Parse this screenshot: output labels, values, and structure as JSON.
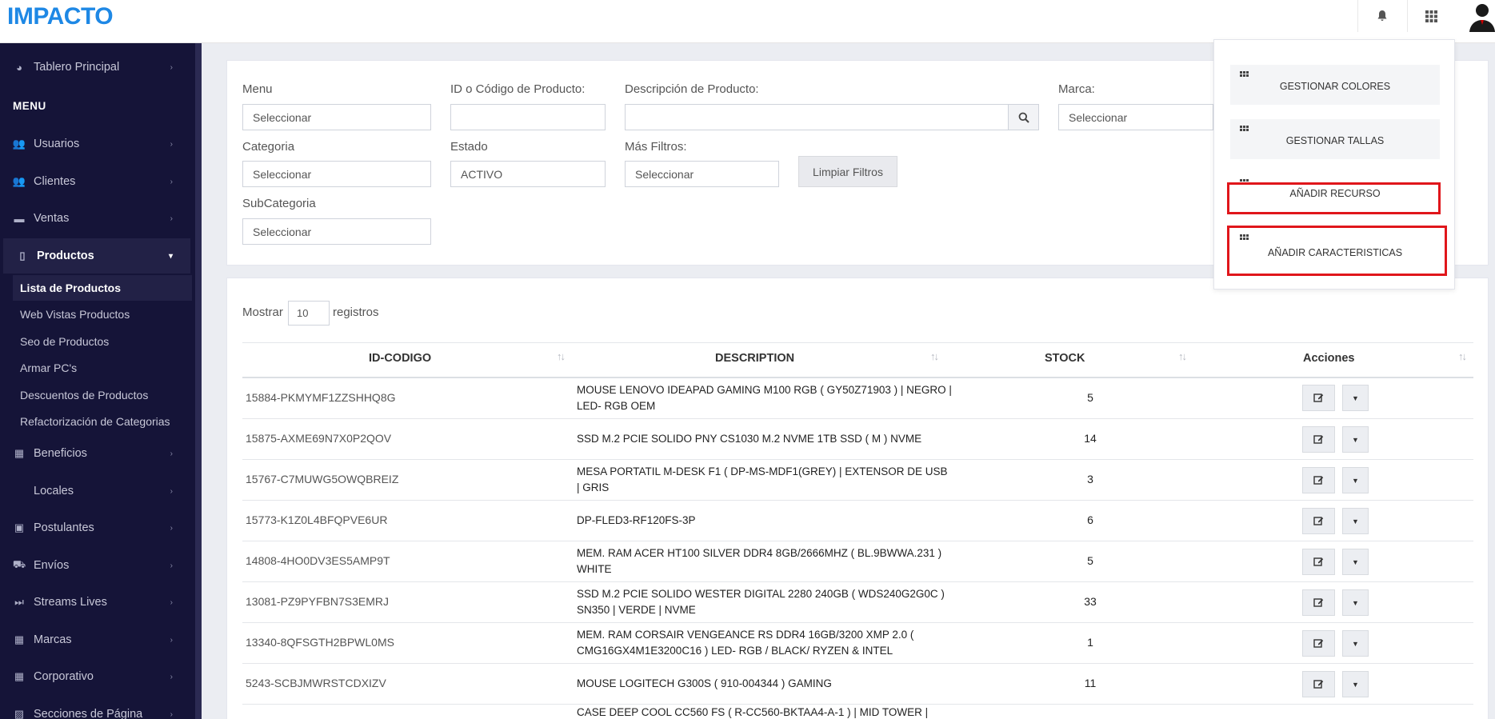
{
  "app": {
    "logo": "IMPACTO"
  },
  "sidebar": {
    "top_item": "Tablero Principal",
    "menu_header": "MENU",
    "items": [
      {
        "label": "Usuarios",
        "icon": "users-icon"
      },
      {
        "label": "Clientes",
        "icon": "users-icon"
      },
      {
        "label": "Ventas",
        "icon": "money-icon"
      },
      {
        "label": "Productos",
        "icon": "box-icon",
        "active": true
      },
      {
        "label": "Beneficios",
        "icon": "grid-icon"
      },
      {
        "label": "Locales",
        "icon": ""
      },
      {
        "label": "Postulantes",
        "icon": "briefcase-icon"
      },
      {
        "label": "Envíos",
        "icon": "truck-icon"
      },
      {
        "label": "Streams Lives",
        "icon": "skip-icon"
      },
      {
        "label": "Marcas",
        "icon": "grid-icon"
      },
      {
        "label": "Corporativo",
        "icon": "grid-icon"
      },
      {
        "label": "Secciones de Página",
        "icon": "image-icon"
      }
    ],
    "subitems": [
      "Lista de Productos",
      "Web Vistas Productos",
      "Seo de Productos",
      "Armar PC's",
      "Descuentos de Productos",
      "Refactorización de Categorias"
    ]
  },
  "filters": {
    "menu_label": "Menu",
    "menu_value": "Seleccionar",
    "id_label": "ID o Código de Producto:",
    "id_value": "",
    "desc_label": "Descripción de Producto:",
    "desc_value": "",
    "marca_label": "Marca:",
    "marca_value": "Seleccionar",
    "categoria_label": "Categoria",
    "categoria_value": "Seleccionar",
    "estado_label": "Estado",
    "estado_value": "ACTIVO",
    "mas_label": "Más Filtros:",
    "mas_value": "Seleccionar",
    "clear_button": "Limpiar Filtros",
    "subcat_label": "SubCategoria",
    "subcat_value": "Seleccionar"
  },
  "table": {
    "show_label": "Mostrar",
    "page_size": "10",
    "records_label": "registros",
    "headers": [
      "ID-CODIGO",
      "DESCRIPTION",
      "STOCK",
      "Acciones"
    ],
    "rows": [
      {
        "id": "15884-PKMYMF1ZZSHHQ8G",
        "desc": "MOUSE LENOVO IDEAPAD GAMING M100 RGB ( GY50Z71903 ) | NEGRO | LED- RGB OEM",
        "stock": "5"
      },
      {
        "id": "15875-AXME69N7X0P2QOV",
        "desc": "SSD M.2 PCIE SOLIDO PNY CS1030 M.2 NVME 1TB SSD ( M ) NVME",
        "stock": "14"
      },
      {
        "id": "15767-C7MUWG5OWQBREIZ",
        "desc": "MESA PORTATIL M-DESK F1 ( DP-MS-MDF1(GREY) | EXTENSOR DE USB | GRIS",
        "stock": "3"
      },
      {
        "id": "15773-K1Z0L4BFQPVE6UR",
        "desc": "DP-FLED3-RF120FS-3P",
        "stock": "6"
      },
      {
        "id": "14808-4HO0DV3ES5AMP9T",
        "desc": "MEM. RAM ACER HT100 SILVER DDR4 8GB/2666MHZ ( BL.9BWWA.231 ) WHITE",
        "stock": "5"
      },
      {
        "id": "13081-PZ9PYFBN7S3EMRJ",
        "desc": "SSD M.2 PCIE SOLIDO WESTER DIGITAL 2280 240GB ( WDS240G2G0C ) SN350 | VERDE | NVME",
        "stock": "33"
      },
      {
        "id": "13340-8QFSGTH2BPWL0MS",
        "desc": "MEM. RAM CORSAIR VENGEANCE RS DDR4 16GB/3200 XMP 2.0 ( CMG16GX4M1E3200C16 ) LED- RGB / BLACK/ RYZEN & INTEL",
        "stock": "1"
      },
      {
        "id": "5243-SCBJMWRSTCDXIZV",
        "desc": "MOUSE LOGITECH G300S ( 910-004344 ) GAMING",
        "stock": "11"
      },
      {
        "id": "",
        "desc": "CASE DEEP COOL CC560 FS ( R-CC560-BKTAA4-A-1 ) | MID TOWER |",
        "stock": ""
      }
    ]
  },
  "dropdown": {
    "items": [
      "GESTIONAR COLORES",
      "GESTIONAR TALLAS",
      "AÑADIR RECURSO",
      "AÑADIR CARACTERISTICAS"
    ],
    "highlight_color": "#e0161b"
  },
  "colors": {
    "brand": "#1e88e5",
    "sidebar": "#151438"
  }
}
